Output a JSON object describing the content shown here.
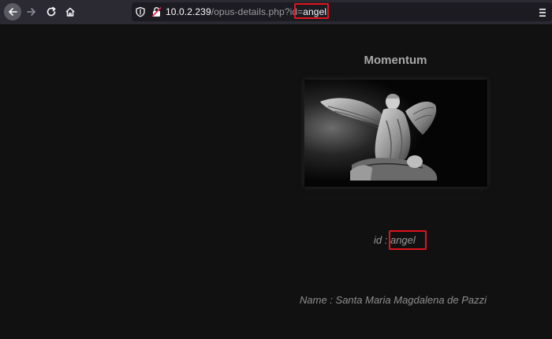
{
  "browser": {
    "url_host": "10.0.2.239",
    "url_path": "/opus-details.php?id=",
    "url_param": "angel",
    "icons": [
      "back-icon",
      "forward-icon",
      "reload-icon",
      "home-icon",
      "shield-icon",
      "insecure-lock-icon",
      "menu-icon"
    ]
  },
  "page": {
    "title": "Momentum",
    "image_alt": "angel statue",
    "id_label": "id :",
    "id_value": "angel",
    "name_label": "Name :",
    "name_value": "Santa Maria Magdalena de Pazzi"
  },
  "colors": {
    "background": "#111111",
    "toolbar": "#2b2a33",
    "highlight_box": "#e0141e"
  }
}
